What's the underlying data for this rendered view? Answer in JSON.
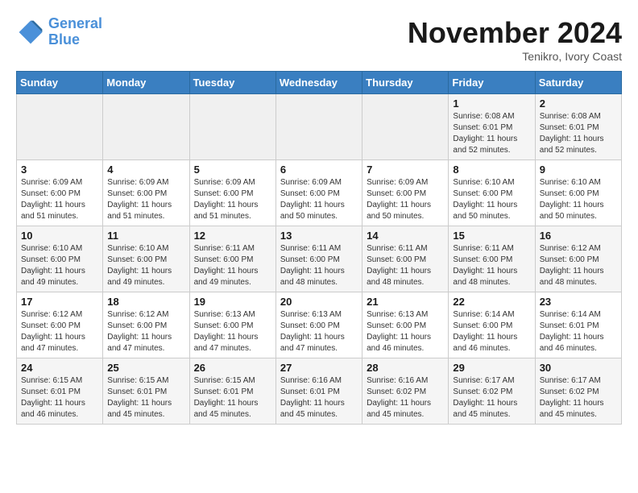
{
  "header": {
    "logo_line1": "General",
    "logo_line2": "Blue",
    "month": "November 2024",
    "location": "Tenikro, Ivory Coast"
  },
  "weekdays": [
    "Sunday",
    "Monday",
    "Tuesday",
    "Wednesday",
    "Thursday",
    "Friday",
    "Saturday"
  ],
  "weeks": [
    [
      {
        "day": "",
        "info": ""
      },
      {
        "day": "",
        "info": ""
      },
      {
        "day": "",
        "info": ""
      },
      {
        "day": "",
        "info": ""
      },
      {
        "day": "",
        "info": ""
      },
      {
        "day": "1",
        "info": "Sunrise: 6:08 AM\nSunset: 6:01 PM\nDaylight: 11 hours\nand 52 minutes."
      },
      {
        "day": "2",
        "info": "Sunrise: 6:08 AM\nSunset: 6:01 PM\nDaylight: 11 hours\nand 52 minutes."
      }
    ],
    [
      {
        "day": "3",
        "info": "Sunrise: 6:09 AM\nSunset: 6:00 PM\nDaylight: 11 hours\nand 51 minutes."
      },
      {
        "day": "4",
        "info": "Sunrise: 6:09 AM\nSunset: 6:00 PM\nDaylight: 11 hours\nand 51 minutes."
      },
      {
        "day": "5",
        "info": "Sunrise: 6:09 AM\nSunset: 6:00 PM\nDaylight: 11 hours\nand 51 minutes."
      },
      {
        "day": "6",
        "info": "Sunrise: 6:09 AM\nSunset: 6:00 PM\nDaylight: 11 hours\nand 50 minutes."
      },
      {
        "day": "7",
        "info": "Sunrise: 6:09 AM\nSunset: 6:00 PM\nDaylight: 11 hours\nand 50 minutes."
      },
      {
        "day": "8",
        "info": "Sunrise: 6:10 AM\nSunset: 6:00 PM\nDaylight: 11 hours\nand 50 minutes."
      },
      {
        "day": "9",
        "info": "Sunrise: 6:10 AM\nSunset: 6:00 PM\nDaylight: 11 hours\nand 50 minutes."
      }
    ],
    [
      {
        "day": "10",
        "info": "Sunrise: 6:10 AM\nSunset: 6:00 PM\nDaylight: 11 hours\nand 49 minutes."
      },
      {
        "day": "11",
        "info": "Sunrise: 6:10 AM\nSunset: 6:00 PM\nDaylight: 11 hours\nand 49 minutes."
      },
      {
        "day": "12",
        "info": "Sunrise: 6:11 AM\nSunset: 6:00 PM\nDaylight: 11 hours\nand 49 minutes."
      },
      {
        "day": "13",
        "info": "Sunrise: 6:11 AM\nSunset: 6:00 PM\nDaylight: 11 hours\nand 48 minutes."
      },
      {
        "day": "14",
        "info": "Sunrise: 6:11 AM\nSunset: 6:00 PM\nDaylight: 11 hours\nand 48 minutes."
      },
      {
        "day": "15",
        "info": "Sunrise: 6:11 AM\nSunset: 6:00 PM\nDaylight: 11 hours\nand 48 minutes."
      },
      {
        "day": "16",
        "info": "Sunrise: 6:12 AM\nSunset: 6:00 PM\nDaylight: 11 hours\nand 48 minutes."
      }
    ],
    [
      {
        "day": "17",
        "info": "Sunrise: 6:12 AM\nSunset: 6:00 PM\nDaylight: 11 hours\nand 47 minutes."
      },
      {
        "day": "18",
        "info": "Sunrise: 6:12 AM\nSunset: 6:00 PM\nDaylight: 11 hours\nand 47 minutes."
      },
      {
        "day": "19",
        "info": "Sunrise: 6:13 AM\nSunset: 6:00 PM\nDaylight: 11 hours\nand 47 minutes."
      },
      {
        "day": "20",
        "info": "Sunrise: 6:13 AM\nSunset: 6:00 PM\nDaylight: 11 hours\nand 47 minutes."
      },
      {
        "day": "21",
        "info": "Sunrise: 6:13 AM\nSunset: 6:00 PM\nDaylight: 11 hours\nand 46 minutes."
      },
      {
        "day": "22",
        "info": "Sunrise: 6:14 AM\nSunset: 6:00 PM\nDaylight: 11 hours\nand 46 minutes."
      },
      {
        "day": "23",
        "info": "Sunrise: 6:14 AM\nSunset: 6:01 PM\nDaylight: 11 hours\nand 46 minutes."
      }
    ],
    [
      {
        "day": "24",
        "info": "Sunrise: 6:15 AM\nSunset: 6:01 PM\nDaylight: 11 hours\nand 46 minutes."
      },
      {
        "day": "25",
        "info": "Sunrise: 6:15 AM\nSunset: 6:01 PM\nDaylight: 11 hours\nand 45 minutes."
      },
      {
        "day": "26",
        "info": "Sunrise: 6:15 AM\nSunset: 6:01 PM\nDaylight: 11 hours\nand 45 minutes."
      },
      {
        "day": "27",
        "info": "Sunrise: 6:16 AM\nSunset: 6:01 PM\nDaylight: 11 hours\nand 45 minutes."
      },
      {
        "day": "28",
        "info": "Sunrise: 6:16 AM\nSunset: 6:02 PM\nDaylight: 11 hours\nand 45 minutes."
      },
      {
        "day": "29",
        "info": "Sunrise: 6:17 AM\nSunset: 6:02 PM\nDaylight: 11 hours\nand 45 minutes."
      },
      {
        "day": "30",
        "info": "Sunrise: 6:17 AM\nSunset: 6:02 PM\nDaylight: 11 hours\nand 45 minutes."
      }
    ]
  ]
}
